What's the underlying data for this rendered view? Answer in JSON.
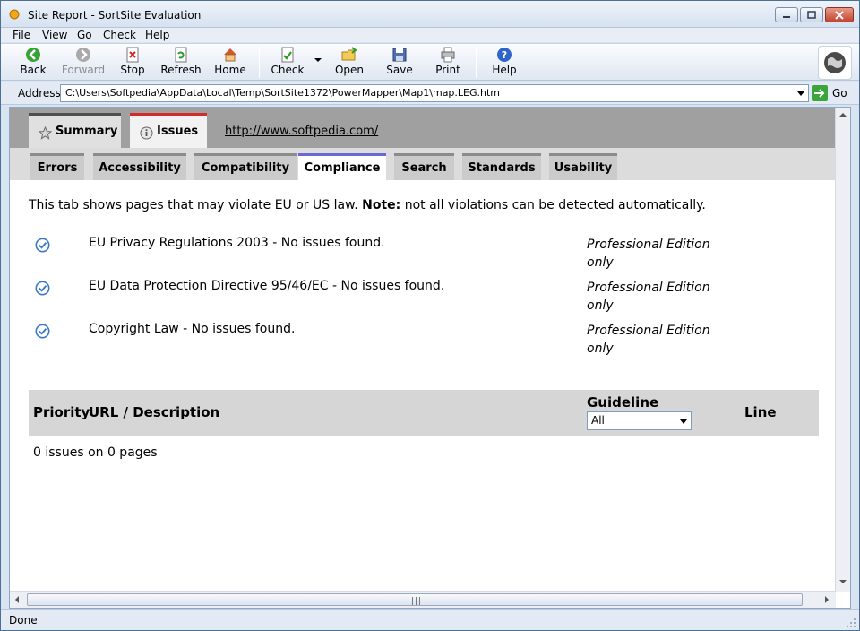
{
  "window": {
    "title": "Site Report - SortSite Evaluation"
  },
  "menu": [
    "File",
    "View",
    "Go",
    "Check",
    "Help"
  ],
  "toolbar": {
    "back": "Back",
    "forward": "Forward",
    "stop": "Stop",
    "refresh": "Refresh",
    "home": "Home",
    "check": "Check",
    "open": "Open",
    "save": "Save",
    "print": "Print",
    "help": "Help"
  },
  "address": {
    "label": "Address",
    "value": "C:\\Users\\Softpedia\\AppData\\Local\\Temp\\SortSite1372\\PowerMapper\\Map1\\map.LEG.htm",
    "go": "Go"
  },
  "tabs": {
    "summary": "Summary",
    "issues": "Issues",
    "site_link": "http://www.softpedia.com/"
  },
  "subtabs": [
    "Errors",
    "Accessibility",
    "Compatibility",
    "Compliance",
    "Search",
    "Standards",
    "Usability"
  ],
  "active_subtab": "Compliance",
  "intro": {
    "before": "This tab shows pages that may violate EU or US law. ",
    "bold": "Note:",
    "after": " not all violations can be detected automatically."
  },
  "rows": [
    {
      "text": "EU Privacy Regulations 2003 - No issues found.",
      "edition": "Professional Edition only"
    },
    {
      "text": "EU Data Protection Directive 95/46/EC - No issues found.",
      "edition": "Professional Edition only"
    },
    {
      "text": "Copyright Law - No issues found.",
      "edition": "Professional Edition only"
    }
  ],
  "table": {
    "priority": "Priority",
    "url": "URL / Description",
    "guideline": "Guideline",
    "guideline_selected": "All",
    "line": "Line",
    "summary": "0 issues on 0 pages"
  },
  "status": "Done",
  "colors": {
    "active_main_tab": "#d32a2a",
    "active_sub_tab": "#6a6ad0",
    "check_icon": "#3a78c8"
  }
}
